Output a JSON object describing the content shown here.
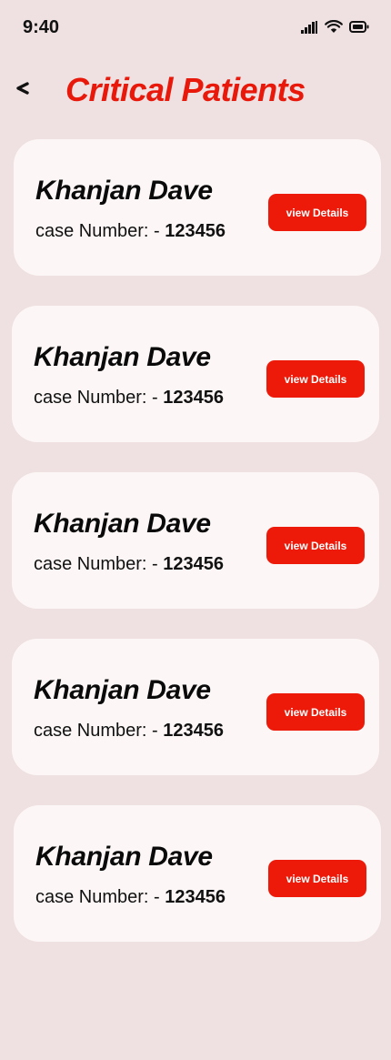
{
  "status_bar": {
    "time": "9:40",
    "icons": [
      "signal-icon",
      "wifi-icon",
      "battery-icon"
    ]
  },
  "header": {
    "back_icon": "chevron-left-icon",
    "title": "Critical Patients"
  },
  "colors": {
    "background": "#efe0e1",
    "card": "#fcf7f6",
    "accent": "#ed1a0a",
    "title": "#e8180b"
  },
  "patients": [
    {
      "name": "Khanjan Dave",
      "case_label": "case Number: - ",
      "case_number": "123456",
      "button_label": "view Details"
    },
    {
      "name": "Khanjan Dave",
      "case_label": "case Number: - ",
      "case_number": "123456",
      "button_label": "view Details"
    },
    {
      "name": "Khanjan Dave",
      "case_label": "case Number: - ",
      "case_number": "123456",
      "button_label": "view Details"
    },
    {
      "name": "Khanjan Dave",
      "case_label": "case Number: - ",
      "case_number": "123456",
      "button_label": "view Details"
    },
    {
      "name": "Khanjan Dave",
      "case_label": "case Number: - ",
      "case_number": "123456",
      "button_label": "view Details"
    }
  ]
}
